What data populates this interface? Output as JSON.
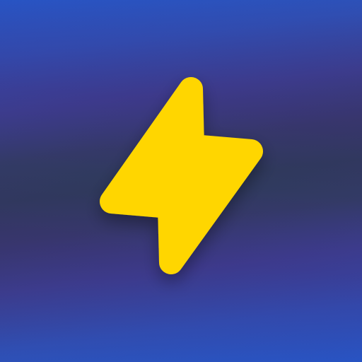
{
  "app_icon": {
    "symbol": "lightning-bolt-icon",
    "colors": {
      "bolt": "#FFD600",
      "background_top": "#2657C8",
      "background_mid": "#2E3A5A",
      "background_bottom": "#2657C8"
    }
  }
}
